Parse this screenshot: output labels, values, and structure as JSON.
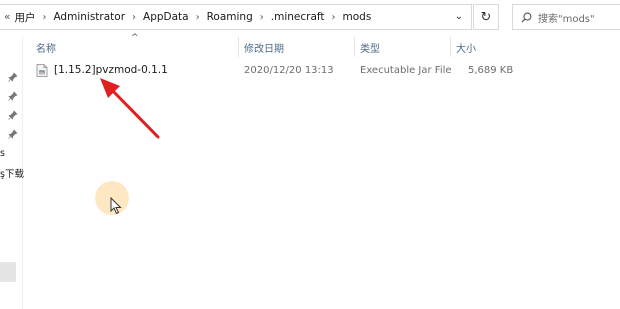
{
  "address_bar": {
    "crumbs": [
      "用户",
      "Administrator",
      "AppData",
      "Roaming",
      ".minecraft",
      "mods"
    ],
    "overflow_glyph": "«",
    "dropdown_glyph": "⌄"
  },
  "refresh_glyph": "↻",
  "search": {
    "placeholder": "搜索\"mods\""
  },
  "nav": {
    "partial_items": [
      "s",
      "ş下载"
    ]
  },
  "columns": {
    "name": "名称",
    "date": "修改日期",
    "type": "类型",
    "size": "大小",
    "sort_glyph": "^"
  },
  "files": [
    {
      "name": "[1.15.2]pvzmod-0.1.1",
      "modified": "2020/12/20 13:13",
      "type": "Executable Jar File",
      "size": "5,689 KB"
    }
  ],
  "colors": {
    "annotation_arrow": "#e02020",
    "cursor_halo": "#fdd694",
    "header_text": "#4d6a8a"
  },
  "icons": [
    "pin-icon",
    "search-icon",
    "refresh-icon",
    "jar-file-icon",
    "mouse-cursor-icon"
  ]
}
